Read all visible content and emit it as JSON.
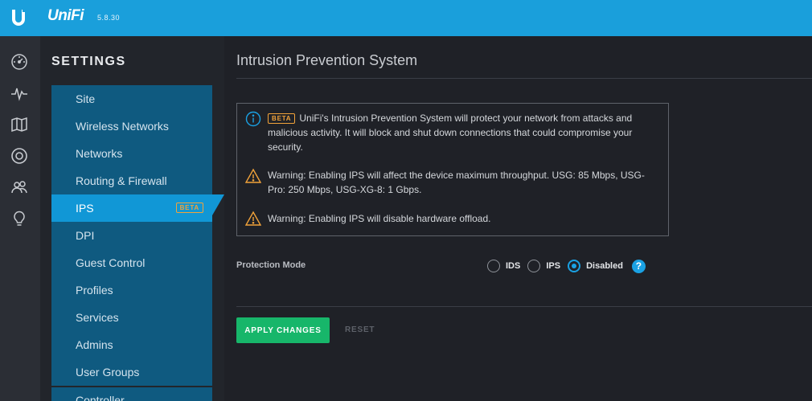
{
  "header": {
    "product": "UniFi",
    "version": "5.8.30"
  },
  "icon_rail": [
    {
      "icon": "dashboard-icon"
    },
    {
      "icon": "statistics-icon"
    },
    {
      "icon": "map-icon"
    },
    {
      "icon": "devices-icon"
    },
    {
      "icon": "clients-icon"
    },
    {
      "icon": "insights-icon"
    }
  ],
  "settings": {
    "title": "SETTINGS",
    "items": [
      {
        "label": "Site"
      },
      {
        "label": "Wireless Networks"
      },
      {
        "label": "Networks"
      },
      {
        "label": "Routing & Firewall"
      },
      {
        "label": "IPS",
        "badge": "BETA",
        "active": true
      },
      {
        "label": "DPI"
      },
      {
        "label": "Guest Control"
      },
      {
        "label": "Profiles"
      },
      {
        "label": "Services"
      },
      {
        "label": "Admins"
      },
      {
        "label": "User Groups"
      },
      {
        "label": "Controller"
      }
    ]
  },
  "page": {
    "title": "Intrusion Prevention System",
    "notice": {
      "beta_badge": "BETA",
      "info_text": "UniFi's Intrusion Prevention System will protect your network from attacks and malicious activity. It will block and shut down connections that could compromise your security.",
      "warning_1": "Warning: Enabling IPS will affect the device maximum throughput. USG: 85 Mbps, USG-Pro: 250 Mbps, USG-XG-8: 1 Gbps.",
      "warning_2": "Warning: Enabling IPS will disable hardware offload."
    },
    "protection_mode": {
      "label": "Protection Mode",
      "options": [
        "IDS",
        "IPS",
        "Disabled"
      ],
      "selected": "Disabled"
    },
    "buttons": {
      "apply": "APPLY CHANGES",
      "reset": "RESET"
    }
  },
  "colors": {
    "topbar": "#1a9fdb",
    "active_nav": "#1197d6",
    "nav": "#0f5a80",
    "apply": "#17b66a",
    "warning": "#f2a33a",
    "accent": "#1aa1e3"
  }
}
